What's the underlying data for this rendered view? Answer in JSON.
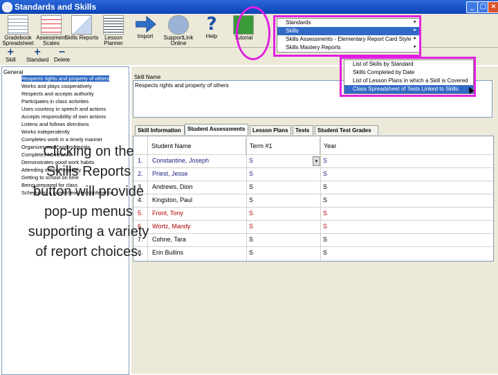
{
  "window": {
    "title": "Standards and Skills",
    "controls": [
      "_",
      "□",
      "×"
    ]
  },
  "toolbar": [
    {
      "label": "Gradebook Spreadsheet",
      "icon": "spreadsheet-icon"
    },
    {
      "label": "Assessment Scales",
      "icon": "grades-icon"
    },
    {
      "label": "Skills Reports",
      "icon": "report-icon"
    },
    {
      "label": "Lesson Planner",
      "icon": "planner-icon"
    },
    {
      "label": "Import",
      "icon": "import-arrow-icon"
    },
    {
      "label": "SupportLink Online",
      "icon": "support-icon"
    },
    {
      "label": "Help",
      "icon": "help-icon"
    },
    {
      "label": "Tutorial",
      "icon": "tutorial-icon"
    }
  ],
  "subtoolbar": [
    {
      "symbol": "+",
      "label": "Skill"
    },
    {
      "symbol": "+",
      "label": "Standard"
    },
    {
      "symbol": "−",
      "label": "Delete"
    }
  ],
  "tree": {
    "root": "General",
    "items": [
      "Respects rights and property of others",
      "Works and plays cooperatively",
      "Respects and accepts authority",
      "Participates in class activities",
      "Uses courtesy in speech and actions",
      "Accepts responsibility of own actions",
      "Listens and follows directions",
      "Works independently",
      "Completes work in a timely manner",
      "Organizes work and materials",
      "Completes homework",
      "Demonstrates good work habits",
      "Attending school regularly",
      "Getting to school on time",
      "Being prepared for class",
      "Scheduling a parent/teacher conference"
    ],
    "selected_index": 0
  },
  "skill_name": {
    "label": "Skill Name",
    "value": "Respects rights and property of others"
  },
  "tabs": [
    "Skill Information",
    "Student Assessments",
    "Lesson Plans",
    "Tests",
    "Student Test Grades"
  ],
  "active_tab": 1,
  "grid": {
    "columns": [
      "Student Name",
      "Term #1",
      "Year"
    ],
    "rows": [
      {
        "num": "1.",
        "name": "Constantine, Joseph",
        "term": "S",
        "year": "S",
        "color": "blue"
      },
      {
        "num": "2.",
        "name": "Priest, Jesse",
        "term": "S",
        "year": "S",
        "color": "blue"
      },
      {
        "num": "3.",
        "name": "Andrews, Dion",
        "term": "S",
        "year": "S",
        "color": "black"
      },
      {
        "num": "4.",
        "name": "Kingston, Paul",
        "term": "S",
        "year": "S",
        "color": "black"
      },
      {
        "num": "5.",
        "name": "Front, Tony",
        "term": "S",
        "year": "S",
        "color": "red"
      },
      {
        "num": "6.",
        "name": "Wortz, Mandy",
        "term": "S",
        "year": "S",
        "color": "red"
      },
      {
        "num": "7.",
        "name": "Cohne, Tara",
        "term": "S",
        "year": "S",
        "color": "black"
      },
      {
        "num": "8.",
        "name": "Erin Bullins",
        "term": "S",
        "year": "S",
        "color": "black"
      }
    ]
  },
  "menu1": {
    "items": [
      {
        "label": "Standards",
        "arrow": "▸"
      },
      {
        "label": "Skills",
        "arrow": "▸"
      },
      {
        "label": "Skills Assessments - Elementary Report Card Style",
        "arrow": "▸"
      },
      {
        "label": "Skills Mastery Reports",
        "arrow": "▸"
      }
    ],
    "selected_index": 1
  },
  "menu2": {
    "items": [
      "List of Skills by Standard",
      "Skills Completed by Date",
      "List of Lesson Plans in which a Skill is Covered",
      "Class Spreadsheet of Tests Linked to Skills"
    ],
    "selected_index": 3
  },
  "caption": "Clicking on the Skills Reports button will provide pop-up menus supporting a variety of report choices.",
  "colors": {
    "highlight": "#e020e0",
    "selection": "#316ac5",
    "titlebar": "#0b43b6"
  }
}
